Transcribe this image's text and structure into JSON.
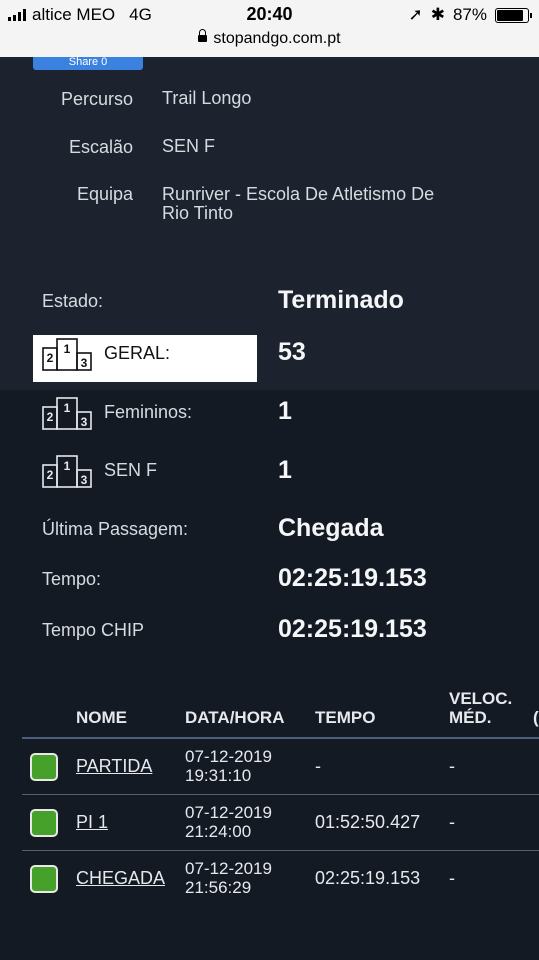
{
  "status_bar": {
    "carrier": "altice MEO",
    "network": "4G",
    "time": "20:40",
    "battery": "87%",
    "battery_level": 0.87,
    "url": "stopandgo.com.pt"
  },
  "share": {
    "label": "Share 0"
  },
  "details": [
    {
      "label": "Percurso",
      "value": "Trail Longo"
    },
    {
      "label": "Escalão",
      "value": "SEN F"
    },
    {
      "label": "Equipa",
      "value_line1": "Runriver - Escola De Atletismo De",
      "value_line2": "Rio Tinto"
    }
  ],
  "stats": {
    "estado": {
      "label": "Estado:",
      "value": "Terminado"
    },
    "geral": {
      "label": "GERAL:",
      "value": "53"
    },
    "femininos": {
      "label": "Femininos:",
      "value": "1"
    },
    "senf": {
      "label": "SEN F",
      "value": "1"
    },
    "ultima": {
      "label": "Última Passagem:",
      "value": "Chegada"
    },
    "tempo": {
      "label": "Tempo:",
      "value": "02:25:19.153"
    },
    "chip": {
      "label": "Tempo CHIP",
      "value": "02:25:19.153"
    }
  },
  "podium_digits": {
    "first": "1",
    "second": "2",
    "third": "3"
  },
  "table": {
    "headers": {
      "nome": "NOME",
      "data": "DATA/HORA",
      "tempo": "TEMPO",
      "veloc_1": "VELOC.",
      "veloc_2": "MÉD.",
      "cut": "("
    },
    "rows": [
      {
        "nome": "PARTIDA",
        "date": "07-12-2019",
        "hour": "19:31:10",
        "tempo": "-",
        "veloc": "-"
      },
      {
        "nome": "PI 1",
        "date": "07-12-2019",
        "hour": "21:24:00",
        "tempo": "01:52:50.427",
        "veloc": "-"
      },
      {
        "nome": "CHEGADA",
        "date": "07-12-2019",
        "hour": "21:56:29",
        "tempo": "02:25:19.153",
        "veloc": "-"
      }
    ]
  },
  "colors": {
    "background": "#141a24",
    "panel": "#1c222e",
    "check": "#45a12a",
    "share": "#3b82e0"
  }
}
